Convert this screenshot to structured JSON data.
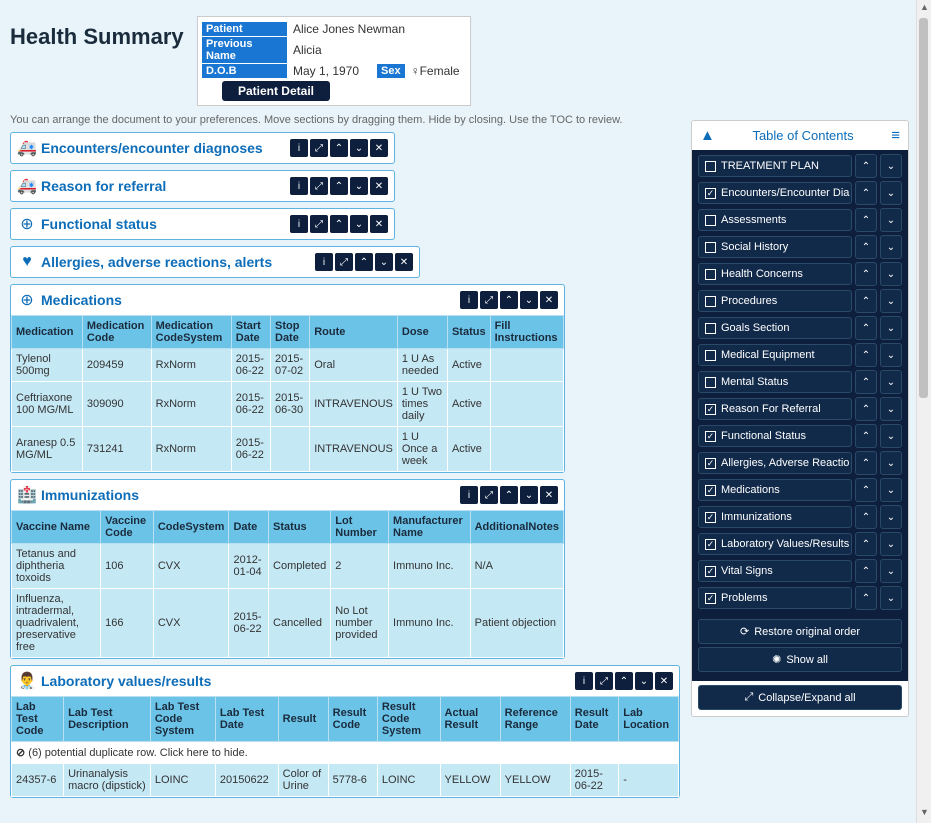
{
  "page": {
    "title": "Health Summary",
    "hint": "You can arrange the document to your preferences. Move sections by dragging them. Hide by closing. Use the TOC to review."
  },
  "patient": {
    "label_patient": "Patient",
    "name": "Alice Jones Newman",
    "label_prev": "Previous Name",
    "prev_name": "Alicia",
    "label_dob": "D.O.B",
    "dob": "May 1, 1970",
    "label_sex": "Sex",
    "sex": "♀Female",
    "detail_btn": "Patient Detail"
  },
  "sections": {
    "encounters": "Encounters/encounter diagnoses",
    "referral": "Reason for referral",
    "functional": "Functional status",
    "allergies": "Allergies, adverse reactions, alerts",
    "medications": "Medications",
    "immunizations": "Immunizations",
    "labs": "Laboratory values/results"
  },
  "medications": {
    "headers": [
      "Medication",
      "Medication Code",
      "Medication CodeSystem",
      "Start Date",
      "Stop Date",
      "Route",
      "Dose",
      "Status",
      "Fill Instructions"
    ],
    "rows": [
      [
        "Tylenol 500mg",
        "209459",
        "RxNorm",
        "2015-06-22",
        "2015-07-02",
        "Oral",
        "1 U As needed",
        "Active",
        ""
      ],
      [
        "Ceftriaxone 100 MG/ML",
        "309090",
        "RxNorm",
        "2015-06-22",
        "2015-06-30",
        "INTRAVENOUS",
        "1 U Two times daily",
        "Active",
        ""
      ],
      [
        "Aranesp 0.5 MG/ML",
        "731241",
        "RxNorm",
        "2015-06-22",
        "",
        "INTRAVENOUS",
        "1 U Once a week",
        "Active",
        ""
      ]
    ]
  },
  "immunizations": {
    "headers": [
      "Vaccine Name",
      "Vaccine Code",
      "CodeSystem",
      "Date",
      "Status",
      "Lot Number",
      "Manufacturer Name",
      "AdditionalNotes"
    ],
    "rows": [
      [
        "Tetanus and diphtheria toxoids",
        "106",
        "CVX",
        "2012-01-04",
        "Completed",
        "2",
        "Immuno Inc.",
        "N/A"
      ],
      [
        "Influenza, intradermal, quadrivalent, preservative free",
        "166",
        "CVX",
        "2015-06-22",
        "Cancelled",
        "No Lot number provided",
        "Immuno Inc.",
        "Patient objection"
      ]
    ]
  },
  "labs": {
    "headers": [
      "Lab Test Code",
      "Lab Test Description",
      "Lab Test Code System",
      "Lab Test Date",
      "Result",
      "Result Code",
      "Result Code System",
      "Actual Result",
      "Reference Range",
      "Result Date",
      "Lab Location"
    ],
    "warning": "(6) potential duplicate row. Click here to hide.",
    "rows": [
      [
        "24357-6",
        "Urinanalysis macro (dipstick)",
        "LOINC",
        "20150622",
        "Color of Urine",
        "5778-6",
        "LOINC",
        "YELLOW",
        "YELLOW",
        "2015-06-22",
        "-"
      ]
    ]
  },
  "toc": {
    "title": "Table of Contents",
    "items": [
      {
        "label": "TREATMENT PLAN",
        "checked": false
      },
      {
        "label": "Encounters/Encounter Dia",
        "checked": true
      },
      {
        "label": "Assessments",
        "checked": false
      },
      {
        "label": "Social History",
        "checked": false
      },
      {
        "label": "Health Concerns",
        "checked": false
      },
      {
        "label": "Procedures",
        "checked": false
      },
      {
        "label": "Goals Section",
        "checked": false
      },
      {
        "label": "Medical Equipment",
        "checked": false
      },
      {
        "label": "Mental Status",
        "checked": false
      },
      {
        "label": "Reason For Referral",
        "checked": true
      },
      {
        "label": "Functional Status",
        "checked": true
      },
      {
        "label": "Allergies, Adverse Reactio",
        "checked": true
      },
      {
        "label": "Medications",
        "checked": true
      },
      {
        "label": "Immunizations",
        "checked": true
      },
      {
        "label": "Laboratory Values/Results",
        "checked": true
      },
      {
        "label": "Vital Signs",
        "checked": true
      },
      {
        "label": "Problems",
        "checked": true
      }
    ],
    "restore": "Restore original order",
    "showall": "Show all",
    "collapse": "Collapse/Expand all"
  }
}
